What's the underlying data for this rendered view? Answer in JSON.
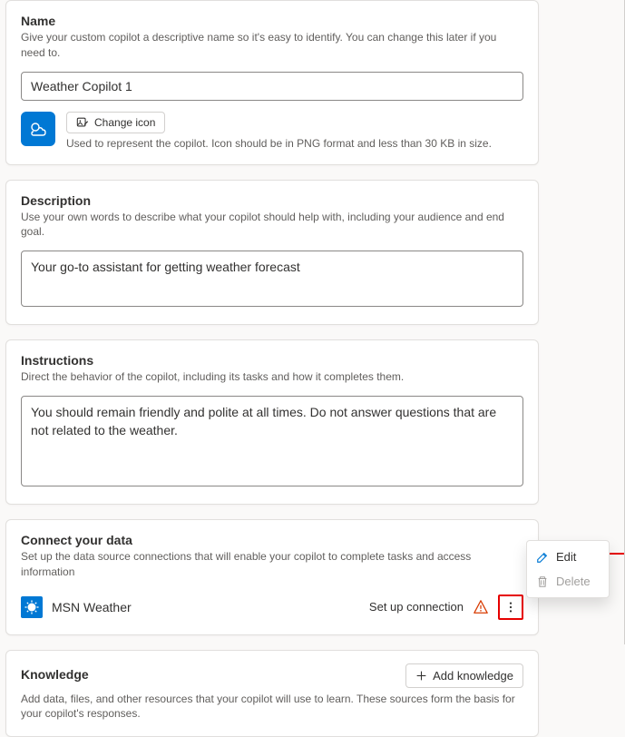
{
  "name_section": {
    "title": "Name",
    "desc": "Give your custom copilot a descriptive name so it's easy to identify. You can change this later if you need to.",
    "value": "Weather Copilot 1",
    "change_icon_label": "Change icon",
    "icon_hint": "Used to represent the copilot. Icon should be in PNG format and less than 30 KB in size."
  },
  "description_section": {
    "title": "Description",
    "desc": "Use your own words to describe what your copilot should help with, including your audience and end goal.",
    "value": "Your go-to assistant for getting weather forecast"
  },
  "instructions_section": {
    "title": "Instructions",
    "desc": "Direct the behavior of the copilot, including its tasks and how it completes them.",
    "value": "You should remain friendly and polite at all times. Do not answer questions that are not related to the weather."
  },
  "connect_section": {
    "title": "Connect your data",
    "desc": "Set up the data source connections that will enable your copilot to complete tasks and access information",
    "connection_name": "MSN Weather",
    "setup_label": "Set up connection"
  },
  "knowledge_section": {
    "title": "Knowledge",
    "desc": "Add data, files, and other resources that your copilot will use to learn. These sources form the basis for your copilot's responses.",
    "add_label": "Add knowledge"
  },
  "menu": {
    "edit": "Edit",
    "delete": "Delete"
  }
}
